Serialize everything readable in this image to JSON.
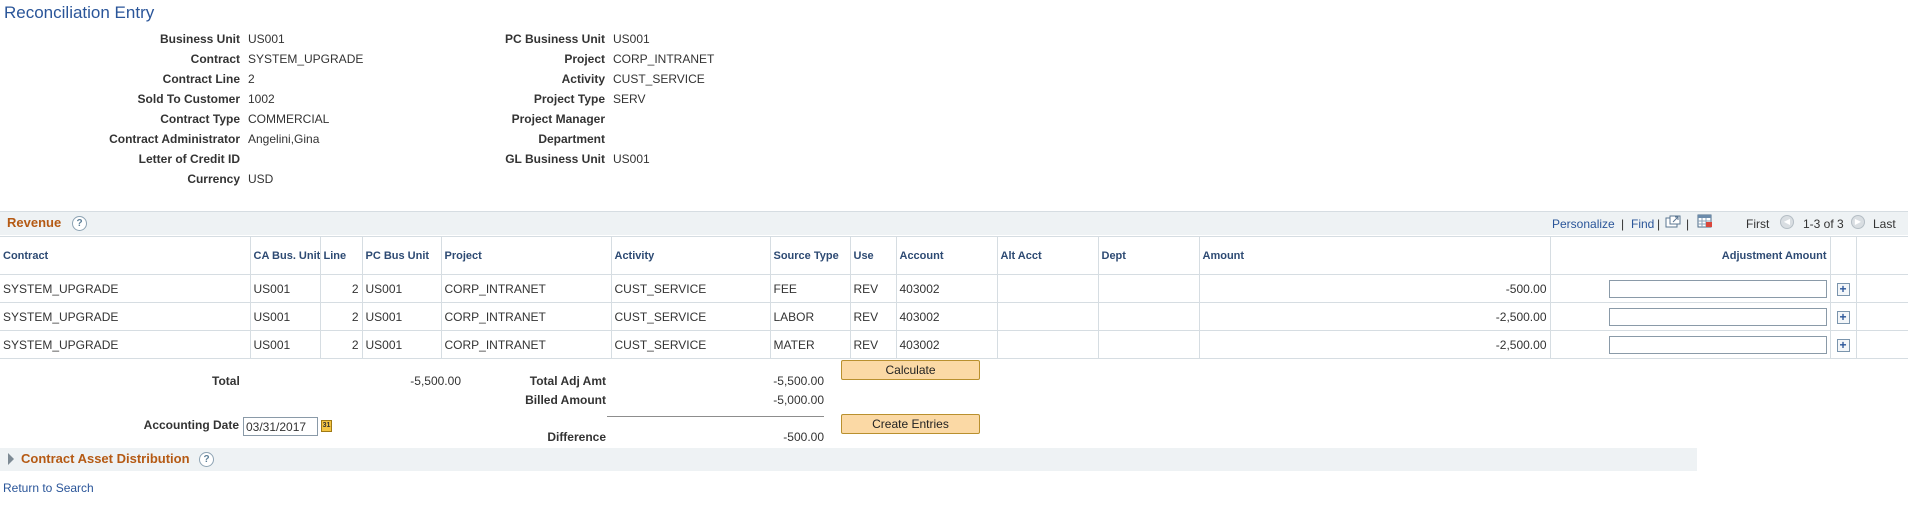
{
  "page": {
    "title": "Reconciliation Entry"
  },
  "header_left": [
    {
      "label": "Business Unit",
      "value": "US001"
    },
    {
      "label": "Contract",
      "value": "SYSTEM_UPGRADE"
    },
    {
      "label": "Contract Line",
      "value": "2"
    },
    {
      "label": "Sold To Customer",
      "value": "1002"
    },
    {
      "label": "Contract Type",
      "value": "COMMERCIAL"
    },
    {
      "label": "Contract Administrator",
      "value": "Angelini,Gina"
    },
    {
      "label": "Letter of Credit ID",
      "value": ""
    },
    {
      "label": "Currency",
      "value": "USD"
    }
  ],
  "header_right": [
    {
      "label": "PC Business Unit",
      "value": "US001"
    },
    {
      "label": "Project",
      "value": "CORP_INTRANET"
    },
    {
      "label": "Activity",
      "value": "CUST_SERVICE"
    },
    {
      "label": "Project Type",
      "value": "SERV"
    },
    {
      "label": "Project Manager",
      "value": ""
    },
    {
      "label": "Department",
      "value": ""
    },
    {
      "label": "GL Business Unit",
      "value": "US001"
    }
  ],
  "revenue": {
    "title": "Revenue",
    "help": "?",
    "personalize": "Personalize",
    "find": "Find",
    "separator": "|",
    "first": "First",
    "range": "1-3 of 3",
    "last": "Last",
    "columns": [
      "Contract",
      "CA Bus. Unit",
      "Line",
      "PC Bus Unit",
      "Project",
      "Activity",
      "Source Type",
      "Use",
      "Account",
      "Alt Acct",
      "Dept",
      "Amount",
      "Adjustment Amount"
    ],
    "rows": [
      {
        "contract": "SYSTEM_UPGRADE",
        "ca_bu": "US001",
        "line": "2",
        "pc_bu": "US001",
        "project": "CORP_INTRANET",
        "activity": "CUST_SERVICE",
        "source_type": "FEE",
        "use": "REV",
        "account": "403002",
        "alt_acct": "",
        "dept": "",
        "amount": "-500.00",
        "adj_amount": ""
      },
      {
        "contract": "SYSTEM_UPGRADE",
        "ca_bu": "US001",
        "line": "2",
        "pc_bu": "US001",
        "project": "CORP_INTRANET",
        "activity": "CUST_SERVICE",
        "source_type": "LABOR",
        "use": "REV",
        "account": "403002",
        "alt_acct": "",
        "dept": "",
        "amount": "-2,500.00",
        "adj_amount": ""
      },
      {
        "contract": "SYSTEM_UPGRADE",
        "ca_bu": "US001",
        "line": "2",
        "pc_bu": "US001",
        "project": "CORP_INTRANET",
        "activity": "CUST_SERVICE",
        "source_type": "MATER",
        "use": "REV",
        "account": "403002",
        "alt_acct": "",
        "dept": "",
        "amount": "-2,500.00",
        "adj_amount": ""
      }
    ]
  },
  "totals": {
    "total_label": "Total",
    "total_value": "-5,500.00",
    "total_adj_label": "Total Adj Amt",
    "total_adj_value": "-5,500.00",
    "billed_label": "Billed Amount",
    "billed_value": "-5,000.00",
    "difference_label": "Difference",
    "difference_value": "-500.00",
    "accounting_date_label": "Accounting Date",
    "accounting_date_value": "03/31/2017",
    "calculate_label": "Calculate",
    "create_entries_label": "Create Entries"
  },
  "section": {
    "title": "Contract Asset Distribution",
    "help": "?"
  },
  "footer": {
    "return_link": "Return to Search"
  },
  "colors": {
    "accent_link": "#2a5599",
    "section_title": "#b55a14",
    "button_fill": "#fbd9a5"
  }
}
